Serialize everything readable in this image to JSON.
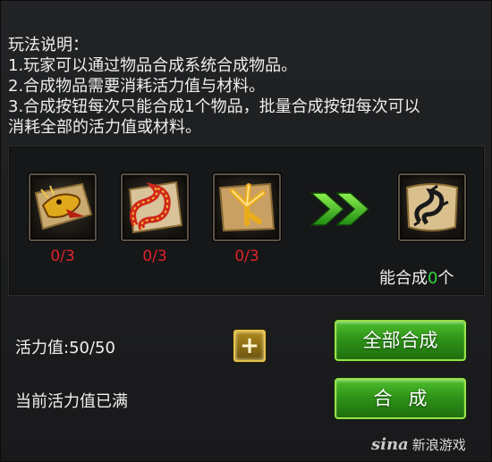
{
  "instructions": {
    "title": "玩法说明：",
    "line1": "1.玩家可以通过物品合成系统合成物品。",
    "line2": "2.合成物品需要消耗活力值与材料。",
    "line3": "3.合成按钮每次只能合成1个物品，批量合成按钮每次可以",
    "line4": "消耗全部的活力值或材料。"
  },
  "materials": [
    {
      "icon": "dragon-head-scroll-icon",
      "count": "0/3"
    },
    {
      "icon": "dragon-body-scroll-icon",
      "count": "0/3"
    },
    {
      "icon": "dragon-claw-scroll-icon",
      "count": "0/3"
    }
  ],
  "result": {
    "icon": "dragon-totem-scroll-icon"
  },
  "can_craft": {
    "prefix": "能合成",
    "count": "0",
    "suffix": "个"
  },
  "stamina": {
    "label": "活力值:50/50",
    "add_icon": "plus-icon",
    "status": "当前活力值已满"
  },
  "buttons": {
    "craft_all": "全部合成",
    "craft_one": "合成"
  },
  "watermark": {
    "logo": "sina",
    "text": "新浪游戏"
  },
  "colors": {
    "count_red": "#e0222a",
    "count_green": "#2fd63a",
    "button_green": "#2f9418",
    "plus_gold": "#e3c24d"
  }
}
